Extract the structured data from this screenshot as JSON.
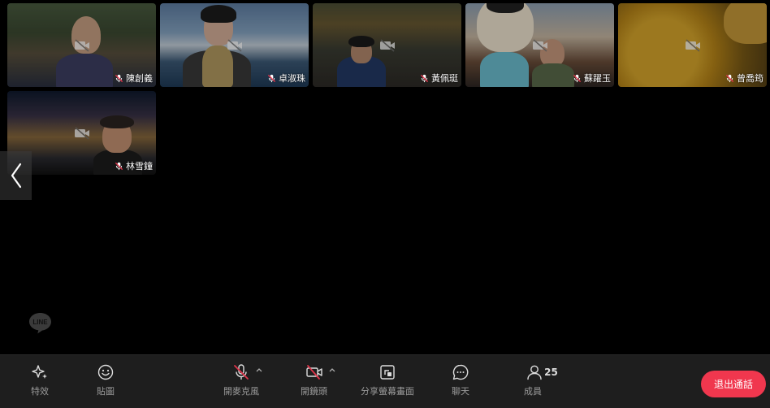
{
  "participants": [
    {
      "name": "陳創義"
    },
    {
      "name": "卓淑珠"
    },
    {
      "name": "黃佩珽"
    },
    {
      "name": "蘇躍玉"
    },
    {
      "name": "曾喬筠"
    },
    {
      "name": "林雪鐘"
    }
  ],
  "toolbar": {
    "effects_label": "特效",
    "stickers_label": "貼圖",
    "mic_label": "開麥克風",
    "camera_label": "開鏡頭",
    "share_label": "分享螢幕畫面",
    "chat_label": "聊天",
    "members_label": "成員",
    "members_count": "25",
    "leave_label": "退出通話"
  },
  "logo": {
    "text": "LINE"
  },
  "colors": {
    "leave": "#f0374e",
    "toolbar_bg": "#1e1e1e",
    "muted_icon": "#e0344a"
  },
  "icons": {
    "effects": "sparkle-icon",
    "stickers": "smiley-icon",
    "mic": "mic-off-icon",
    "camera": "camera-off-icon",
    "share": "share-screen-icon",
    "chat": "chat-bubble-icon",
    "members": "person-icon",
    "muted": "mic-muted-icon",
    "video_off": "video-off-icon",
    "prev": "chevron-left-icon"
  }
}
